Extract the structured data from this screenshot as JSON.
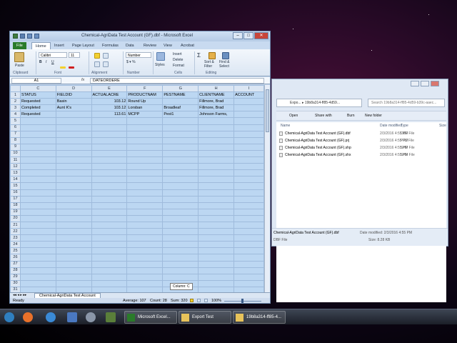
{
  "excel": {
    "title": "Chemical-AgriData Test Account (GF).dbf - Microsoft Excel",
    "tabs": [
      "File",
      "Home",
      "Insert",
      "Page Layout",
      "Formulas",
      "Data",
      "Review",
      "View",
      "Acrobat"
    ],
    "ribbon": {
      "font_name": "Calibri",
      "font_size": "11",
      "number_format": "Number",
      "paste": "Paste",
      "styles": "Styles",
      "insert": "Insert",
      "delete": "Delete",
      "format": "Format",
      "sort_filter": "Sort &\nFilter",
      "find_select": "Find &\nSelect",
      "groups": [
        "Clipboard",
        "Font",
        "Alignment",
        "Number",
        "Cells",
        "Editing"
      ]
    },
    "formula_bar": {
      "name_box": "A1",
      "fx": "fx",
      "value": "DATEORDERE"
    },
    "columns": [
      "C",
      "D",
      "E",
      "F",
      "G",
      "H",
      "I"
    ],
    "rows": [
      [
        "STATUS",
        "FIELDID",
        "ACTUALACRE",
        "PRODUCTNAM",
        "PESTNAME",
        "CLIENTNAME",
        "ACCOUNT"
      ],
      [
        "Requested",
        "Basin",
        "103.12",
        "Round Up",
        "",
        "Fillmore, Brad",
        ""
      ],
      [
        "Completed",
        "Aunt K's",
        "103.12",
        "Lorsban",
        "Broadleaf",
        "Fillmore, Brad",
        ""
      ],
      [
        "Requested",
        "",
        "113.61",
        "MCPP",
        "Pest1",
        "Johnson Farms,",
        ""
      ]
    ],
    "row_numbers": [
      "1",
      "2",
      "3",
      "4",
      "5",
      "6",
      "7",
      "8",
      "9",
      "10",
      "11",
      "12",
      "13",
      "14",
      "15",
      "16",
      "17",
      "18",
      "19",
      "20",
      "21",
      "22",
      "23",
      "24",
      "25",
      "26",
      "27",
      "28",
      "29",
      "30",
      "31"
    ],
    "sheet_tab": "Chemical-AgriData Test Account",
    "tooltip": "Column: C",
    "status": {
      "ready": "Ready",
      "average": "Average: 107",
      "count": "Count: 28",
      "sum": "Sum: 320",
      "zoom": "100%"
    }
  },
  "explorer": {
    "address": "Expo... ▸ 19b8a314-ff85-4d59...",
    "search": "Search 19b8a314-ff85-4d59-b39c-aaec...",
    "toolbar": [
      "Open",
      "Share with",
      "Burn",
      "New folder"
    ],
    "columns": [
      "Name",
      "Date modified",
      "Type",
      "Size"
    ],
    "files": [
      {
        "name": "Chemical-AgriData Test Account (GF).dbf",
        "date": "2/3/2016 4:55 PM",
        "type": "DBF File"
      },
      {
        "name": "Chemical-AgriData Test Account (GF).prj",
        "date": "2/3/2016 4:55 PM",
        "type": "PRJ File"
      },
      {
        "name": "Chemical-AgriData Test Account (GF).shp",
        "date": "2/3/2016 4:55 PM",
        "type": "SHP File"
      },
      {
        "name": "Chemical-AgriData Test Account (GF).shx",
        "date": "2/3/2016 4:55 PM",
        "type": "SHX File"
      }
    ],
    "details": {
      "name": "Chemical-AgriData Test Account (GF).dbf",
      "type": "DBF File",
      "date_label": "Date modified: 2/3/2016 4:55 PM",
      "size_label": "Size: 8.28 KB"
    }
  },
  "desktop_icon": "Export Test",
  "taskbar": {
    "tasks": [
      "Microsoft Excel...",
      "Export Test",
      "19b8a314-ff85-4..."
    ]
  },
  "colors": {
    "cell_bg": "#bcd7f2",
    "file_tab": "#2a7b2a",
    "taskbar": "#1b1f28"
  }
}
